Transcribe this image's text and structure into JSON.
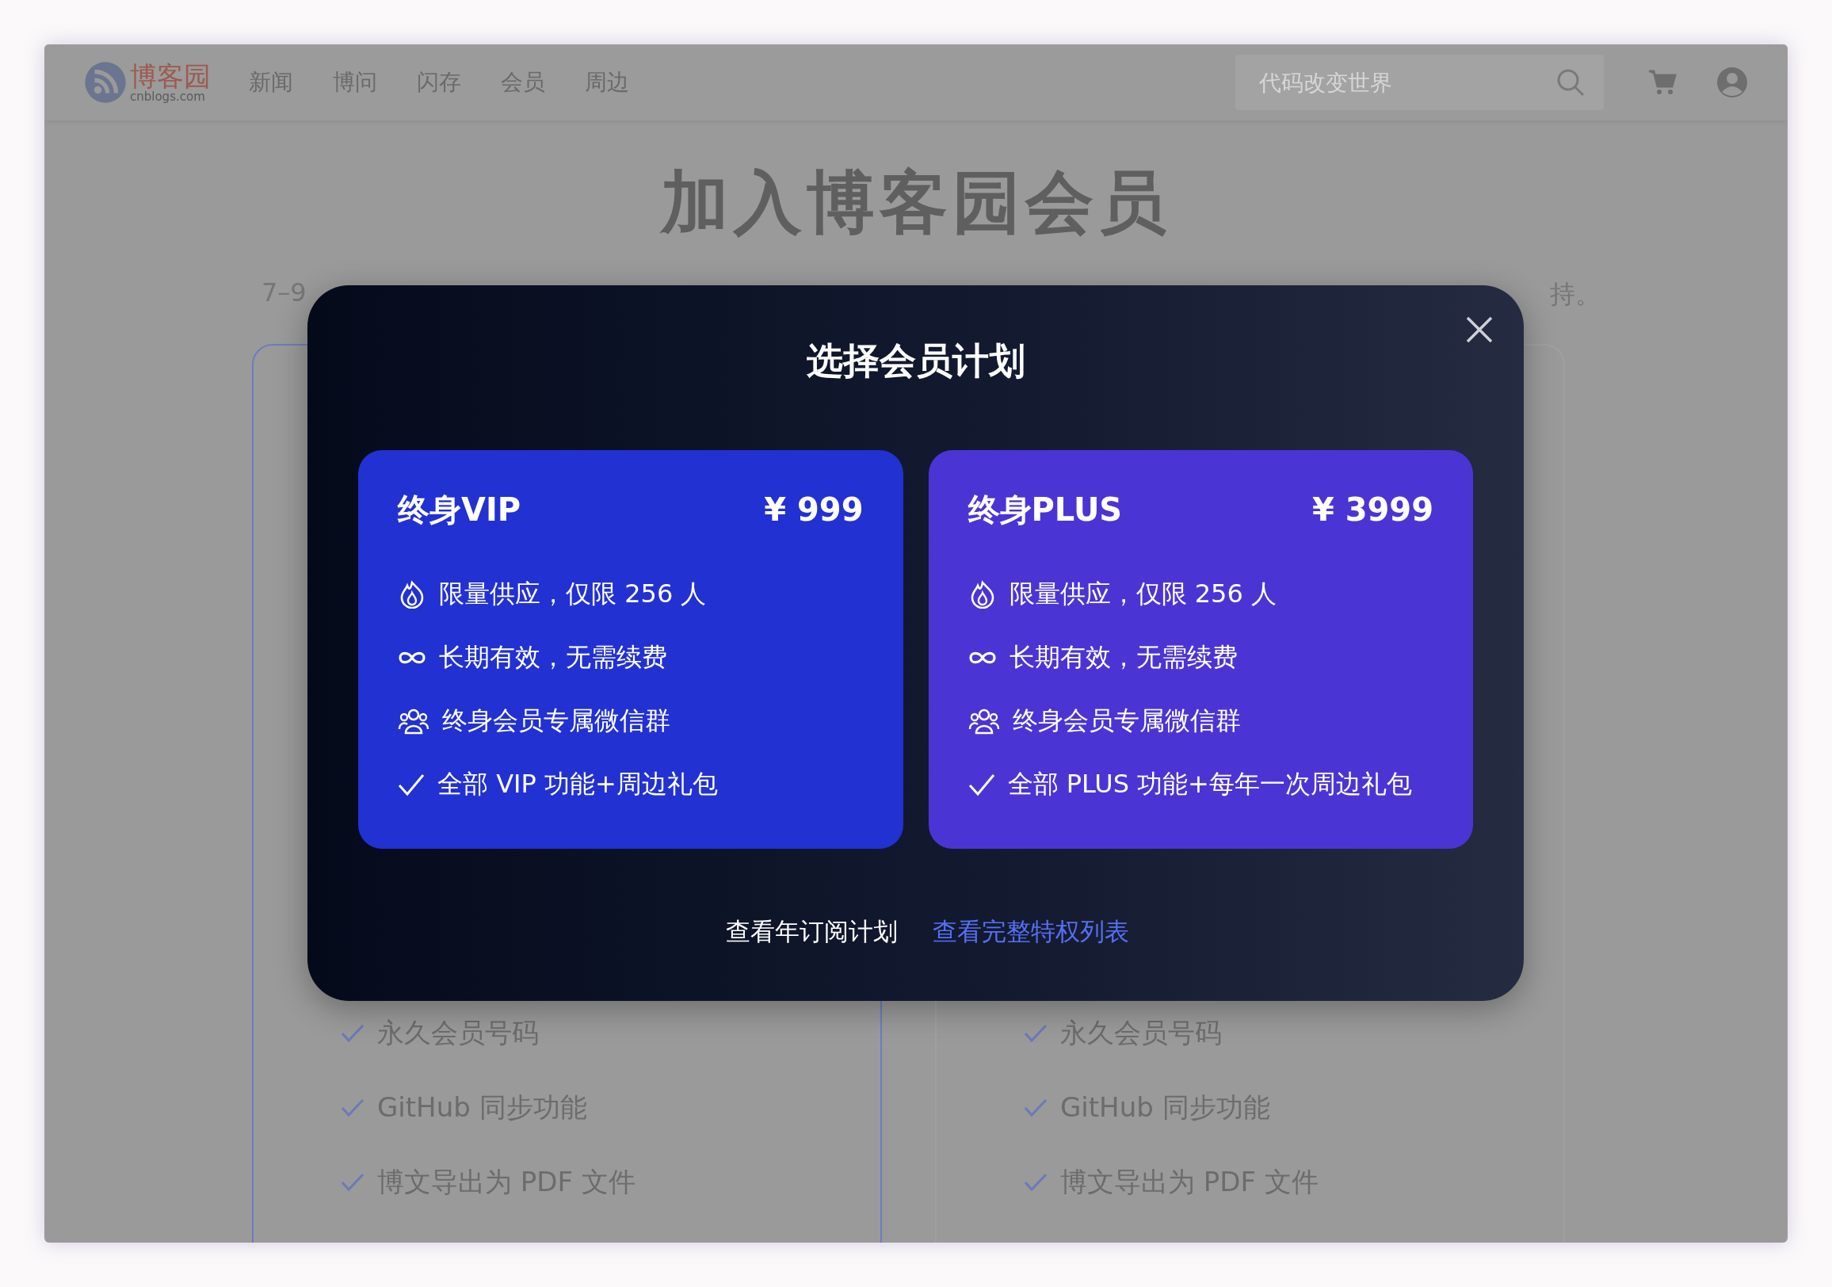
{
  "nav": {
    "logo": {
      "name": "博客园",
      "domain": "cnblogs.com"
    },
    "items": [
      "新闻",
      "博问",
      "闪存",
      "会员",
      "周边"
    ],
    "search": {
      "placeholder": "代码改变世界"
    }
  },
  "page": {
    "title": "加入博客园会员",
    "subtitle_left": "7–9",
    "subtitle_right": "持。",
    "columns": [
      {
        "selected": true,
        "features": [
          "永久会员号码",
          "GitHub 同步功能",
          "博文导出为 PDF 文件"
        ]
      },
      {
        "selected": false,
        "features": [
          "永久会员号码",
          "GitHub 同步功能",
          "博文导出为 PDF 文件"
        ]
      }
    ]
  },
  "modal": {
    "title": "选择会员计划",
    "plans": [
      {
        "name": "终身VIP",
        "price": "¥ 999",
        "color": "#2231d2",
        "features": [
          {
            "kind": "fire",
            "text": "限量供应，仅限 256 人"
          },
          {
            "kind": "infinity",
            "text": "长期有效，无需续费"
          },
          {
            "kind": "group",
            "text": "终身会员专属微信群"
          },
          {
            "kind": "check",
            "text": "全部 VIP 功能+周边礼包"
          }
        ]
      },
      {
        "name": "终身PLUS",
        "price": "¥ 3999",
        "color": "#4a35d4",
        "features": [
          {
            "kind": "fire",
            "text": "限量供应，仅限 256 人"
          },
          {
            "kind": "infinity",
            "text": "长期有效，无需续费"
          },
          {
            "kind": "group",
            "text": "终身会员专属微信群"
          },
          {
            "kind": "check",
            "text": "全部 PLUS 功能+每年一次周边礼包"
          }
        ]
      }
    ],
    "plain_link": "查看年订阅计划",
    "accent_link": "查看完整特权列表"
  }
}
